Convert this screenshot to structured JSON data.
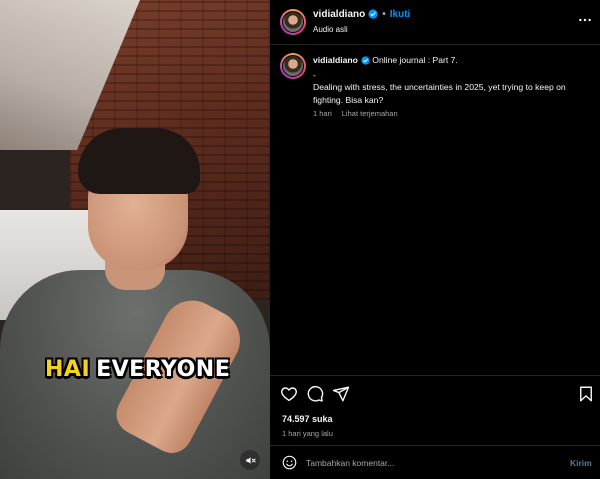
{
  "video": {
    "caption_word1": "HAI",
    "caption_word2": "EVERYONE",
    "caption_colors": {
      "word1": "#f7d21c",
      "word2": "#ffffff"
    },
    "mute_icon": "speaker-muted-icon"
  },
  "header": {
    "username": "vidialdiano",
    "verified_icon": "verified-badge-icon",
    "separator": "•",
    "follow_label": "Ikuti",
    "audio_label": "Audio asli",
    "more_icon": "more-options-icon"
  },
  "post": {
    "username": "vidialdiano",
    "caption_line1": "Online journal : Part 7.",
    "caption_line2": "-",
    "caption_line3": "Dealing with stress, the uncertainties in 2025, yet trying to keep on fighting. Bisa kan?",
    "age": "1 hari",
    "translate_label": "Lihat terjemahan"
  },
  "actions": {
    "like_icon": "heart-icon",
    "comment_icon": "comment-icon",
    "share_icon": "send-icon",
    "save_icon": "bookmark-icon",
    "likes": "74.597 suka",
    "time": "1 hari yang lalu"
  },
  "comment": {
    "emoji_icon": "emoji-icon",
    "placeholder": "Tambahkan komentar...",
    "send_label": "Kirim"
  },
  "colors": {
    "background": "#000000",
    "accent": "#0095f6",
    "secondary_text": "#a8a8a8",
    "send_disabled": "#567a97"
  }
}
